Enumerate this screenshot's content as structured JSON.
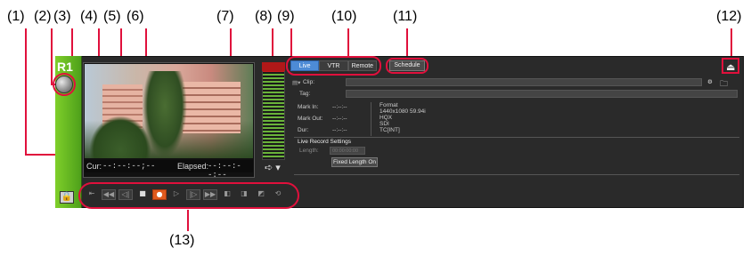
{
  "callouts": [
    "(1)",
    "(2)",
    "(3)",
    "(4)",
    "(5)",
    "(6)",
    "(7)",
    "(8)",
    "(9)",
    "(10)",
    "(11)",
    "(12)",
    "(13)"
  ],
  "recorder": {
    "name": "R1",
    "lock_icon": "lock-icon",
    "status_icon": "status-ball-icon"
  },
  "preview": {
    "cur_label": "Cur:",
    "cur_value": "--:--:--;--",
    "elapsed_label": "Elapsed:",
    "elapsed_value": "--:--:--:--"
  },
  "output_control": {
    "icon": "output-arrow-icon",
    "symbol": "➪ ▾"
  },
  "source_tabs": [
    {
      "label": "Live",
      "active": true
    },
    {
      "label": "VTR",
      "active": false
    },
    {
      "label": "Remote",
      "active": false
    }
  ],
  "schedule_label": "Schedule",
  "eject_symbol": "⏏",
  "clip": {
    "label": "Clip:",
    "tag_label": "Tag:"
  },
  "marks": {
    "mark_in_label": "Mark In:",
    "mark_in_value": "--:--:--",
    "mark_out_label": "Mark Out:",
    "mark_out_value": "--:--:--",
    "dur_label": "Dur:",
    "dur_value": "--:--:--"
  },
  "format": {
    "title": "Format",
    "lines": [
      "1440x1080 59.94i",
      "HQX",
      "SDI",
      "TC[INT]"
    ]
  },
  "live_record": {
    "heading": "Live Record Settings",
    "length_label": "Length:",
    "length_value": "00:00:00:00",
    "fixed_length_label": "Fixed Length On"
  },
  "transport_buttons": [
    "⇤",
    "◀◀",
    "◁|",
    "■",
    "●",
    "▷",
    "|▷",
    "▶▶",
    "◧",
    "◨",
    "◩",
    "⟲"
  ],
  "colors": {
    "accent_green": "#5bb321",
    "callout_red": "#e0103c",
    "tab_active": "#4d8bd6",
    "record_orange": "#e05a1e"
  }
}
